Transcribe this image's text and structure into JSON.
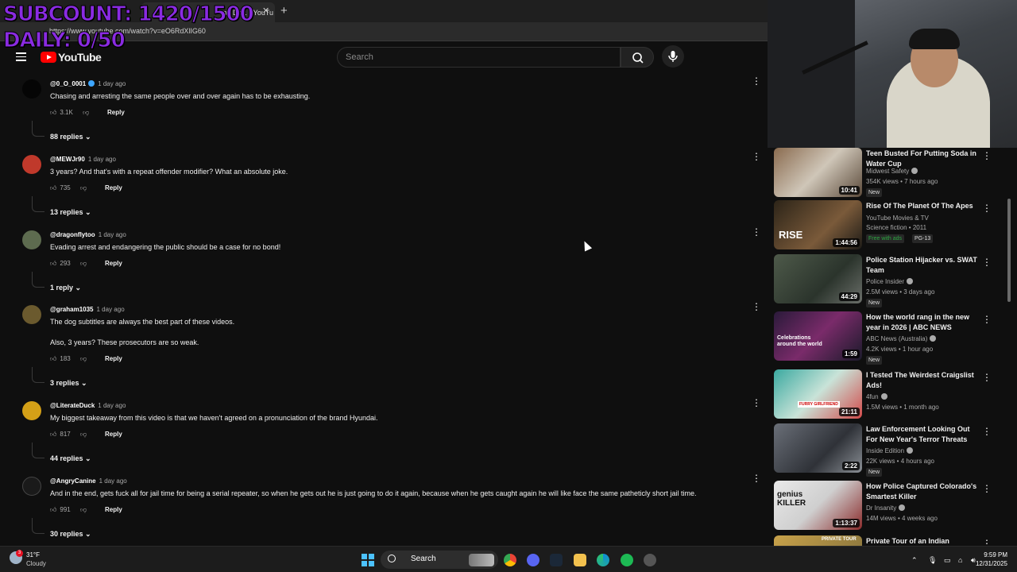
{
  "browser": {
    "tab_title": "me Day. - YouTu",
    "url": "https://www.youtube.com/watch?v=eO6RdXlIG60"
  },
  "overlay": {
    "subcount": "SUBCOUNT: 1420/1500",
    "daily": "DAILY: 0/50"
  },
  "header": {
    "logo": "YouTube",
    "search_placeholder": "Search"
  },
  "comments": [
    {
      "handle": "@0_O_0001",
      "ago": "1 day ago",
      "text": "Chasing and arresting the same people over and over again has to be exhausting.",
      "likes": "3.1K",
      "reply_label": "Reply",
      "replies": "88 replies",
      "verified": true
    },
    {
      "handle": "@MEWJr90",
      "ago": "1 day ago",
      "text": "3 years? And that's with a repeat offender modifier? What an absolute joke.",
      "likes": "735",
      "reply_label": "Reply",
      "replies": "13 replies"
    },
    {
      "handle": "@dragonflytoo",
      "ago": "1 day ago",
      "text": "Evading arrest and endangering the public should be a case for no bond!",
      "likes": "293",
      "reply_label": "Reply",
      "replies": "1 reply"
    },
    {
      "handle": "@graham1035",
      "ago": "1 day ago",
      "text": "The dog subtitles are always the best part of these videos.",
      "text2": "Also, 3 years? These prosecutors are so weak.",
      "likes": "183",
      "reply_label": "Reply",
      "replies": "3 replies"
    },
    {
      "handle": "@LiterateDuck",
      "ago": "1 day ago",
      "text": "My biggest takeaway from this video is that we haven't agreed on a pronunciation of the brand Hyundai.",
      "likes": "817",
      "reply_label": "Reply",
      "replies": "44 replies"
    },
    {
      "handle": "@AngryCanine",
      "ago": "1 day ago",
      "text": "And in the end, gets fuck all for jail time for being a serial repeater, so when he gets out he is just going to do it again, because when he gets caught again he will like face the same patheticly short jail time.",
      "likes": "991",
      "reply_label": "Reply",
      "replies": "30 replies"
    }
  ],
  "sidebar": [
    {
      "title": "Teen Busted For Putting Soda in Water Cup",
      "channel": "Midwest Safety",
      "stats": "354K views • 7 hours ago",
      "badge": "New",
      "duration": "10:41"
    },
    {
      "title": "Rise Of The Planet Of The Apes",
      "channel": "YouTube Movies & TV",
      "stats": "Science fiction • 2011",
      "badge": "Free with ads",
      "badge2": "PG-13",
      "duration": "1:44:56",
      "thumb_text": "RISE"
    },
    {
      "title": "Police Station Hijacker vs. SWAT Team",
      "channel": "Police Insider",
      "stats": "2.5M views • 3 days ago",
      "badge": "New",
      "duration": "44:29"
    },
    {
      "title": "How the world rang in the new year in 2026 | ABC NEWS",
      "channel": "ABC News (Australia)",
      "stats": "4.2K views • 1 hour ago",
      "badge": "New",
      "duration": "1:59",
      "thumb_text": "Celebrations around the world"
    },
    {
      "title": "I Tested The Weirdest Craigslist Ads!",
      "channel": "4fun",
      "stats": "1.5M views • 1 month ago",
      "duration": "21:11",
      "thumb_text": "FURRY GIRLFRIEND"
    },
    {
      "title": "Law Enforcement Looking Out For New Year's Terror Threats",
      "channel": "Inside Edition",
      "stats": "22K views • 4 hours ago",
      "badge": "New",
      "duration": "2:22"
    },
    {
      "title": "How Police Captured Colorado's Smartest Killer",
      "channel": "Dr Insanity",
      "stats": "14M views • 4 weeks ago",
      "duration": "1:13:37",
      "thumb_text": "genius KILLER"
    },
    {
      "title": "Private Tour of an Indian",
      "thumb_text": "PRIVATE TOUR"
    }
  ],
  "taskbar": {
    "temp": "31°F",
    "condition": "Cloudy",
    "weather_badge": "3",
    "search_label": "Search",
    "time": "9:59 PM",
    "date": "12/31/2025"
  },
  "colors": {
    "overlay": "#8a2be2",
    "background": "#0f0f0f",
    "accent_red": "#ff0000"
  }
}
